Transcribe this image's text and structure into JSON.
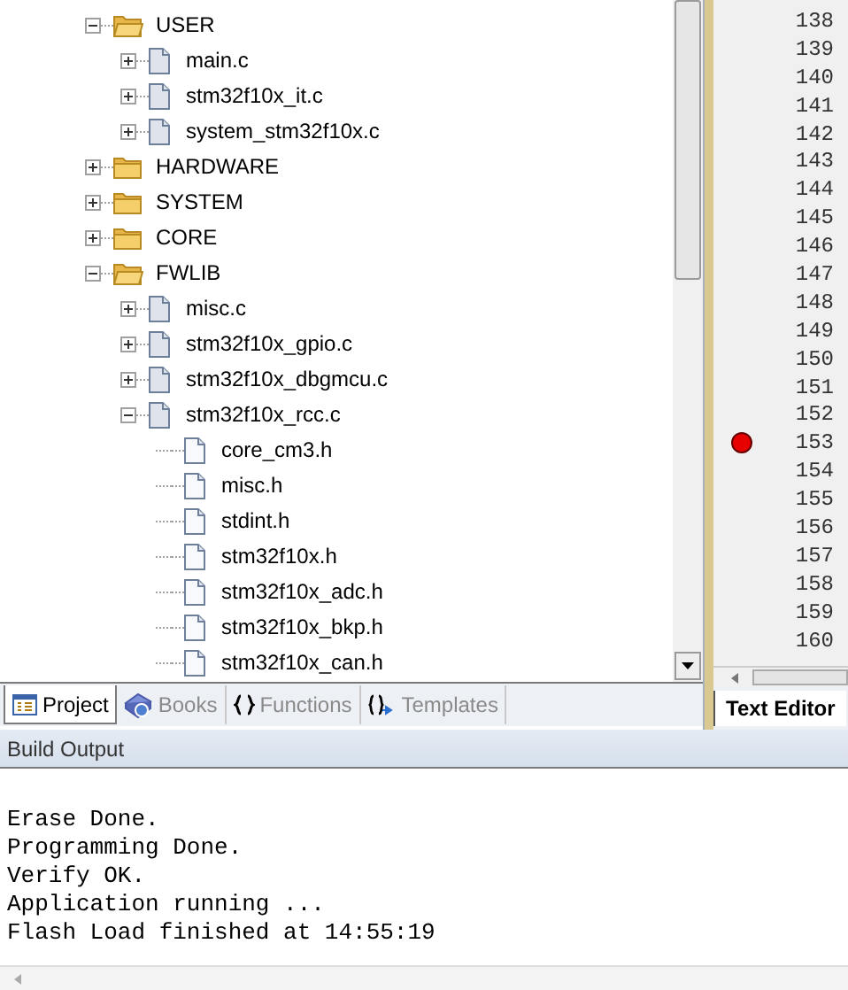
{
  "project_tree": [
    {
      "label": "USER",
      "kind": "folder",
      "expanded": true,
      "children": [
        {
          "label": "main.c",
          "kind": "file",
          "expanded": false
        },
        {
          "label": "stm32f10x_it.c",
          "kind": "file",
          "expanded": false
        },
        {
          "label": "system_stm32f10x.c",
          "kind": "file",
          "expanded": false
        }
      ]
    },
    {
      "label": "HARDWARE",
      "kind": "folder",
      "expanded": false
    },
    {
      "label": "SYSTEM",
      "kind": "folder",
      "expanded": false
    },
    {
      "label": "CORE",
      "kind": "folder",
      "expanded": false
    },
    {
      "label": "FWLIB",
      "kind": "folder",
      "expanded": true,
      "children": [
        {
          "label": "misc.c",
          "kind": "file",
          "expanded": false
        },
        {
          "label": "stm32f10x_gpio.c",
          "kind": "file",
          "expanded": false
        },
        {
          "label": "stm32f10x_dbgmcu.c",
          "kind": "file",
          "expanded": false
        },
        {
          "label": "stm32f10x_rcc.c",
          "kind": "file",
          "expanded": true,
          "children": [
            {
              "label": "core_cm3.h",
              "kind": "header"
            },
            {
              "label": "misc.h",
              "kind": "header"
            },
            {
              "label": "stdint.h",
              "kind": "header"
            },
            {
              "label": "stm32f10x.h",
              "kind": "header"
            },
            {
              "label": "stm32f10x_adc.h",
              "kind": "header"
            },
            {
              "label": "stm32f10x_bkp.h",
              "kind": "header"
            },
            {
              "label": "stm32f10x_can.h",
              "kind": "header"
            }
          ]
        }
      ]
    }
  ],
  "project_tabs": [
    {
      "label": "Project",
      "kind": "project",
      "selected": true
    },
    {
      "label": "Books",
      "kind": "books",
      "selected": false
    },
    {
      "label": "Functions",
      "kind": "functions",
      "selected": false
    },
    {
      "label": "Templates",
      "kind": "templates",
      "selected": false
    }
  ],
  "editor": {
    "lines": [
      {
        "number": "138",
        "breakpoint": false
      },
      {
        "number": "139",
        "breakpoint": false
      },
      {
        "number": "140",
        "breakpoint": false
      },
      {
        "number": "141",
        "breakpoint": false
      },
      {
        "number": "142",
        "breakpoint": false
      },
      {
        "number": "143",
        "breakpoint": false
      },
      {
        "number": "144",
        "breakpoint": false
      },
      {
        "number": "145",
        "breakpoint": false
      },
      {
        "number": "146",
        "breakpoint": false
      },
      {
        "number": "147",
        "breakpoint": false
      },
      {
        "number": "148",
        "breakpoint": false
      },
      {
        "number": "149",
        "breakpoint": false
      },
      {
        "number": "150",
        "breakpoint": false
      },
      {
        "number": "151",
        "breakpoint": false
      },
      {
        "number": "152",
        "breakpoint": false
      },
      {
        "number": "153",
        "breakpoint": true
      },
      {
        "number": "154",
        "breakpoint": false
      },
      {
        "number": "155",
        "breakpoint": false
      },
      {
        "number": "156",
        "breakpoint": false
      },
      {
        "number": "157",
        "breakpoint": false
      },
      {
        "number": "158",
        "breakpoint": false
      },
      {
        "number": "159",
        "breakpoint": false
      },
      {
        "number": "160",
        "breakpoint": false
      }
    ],
    "tab": "Text Editor"
  },
  "build_output": {
    "title": "Build Output",
    "lines": [
      "Erase Done.",
      "Programming Done.",
      "Verify OK.",
      "Application running ...",
      "Flash Load finished at 14:55:19"
    ]
  }
}
